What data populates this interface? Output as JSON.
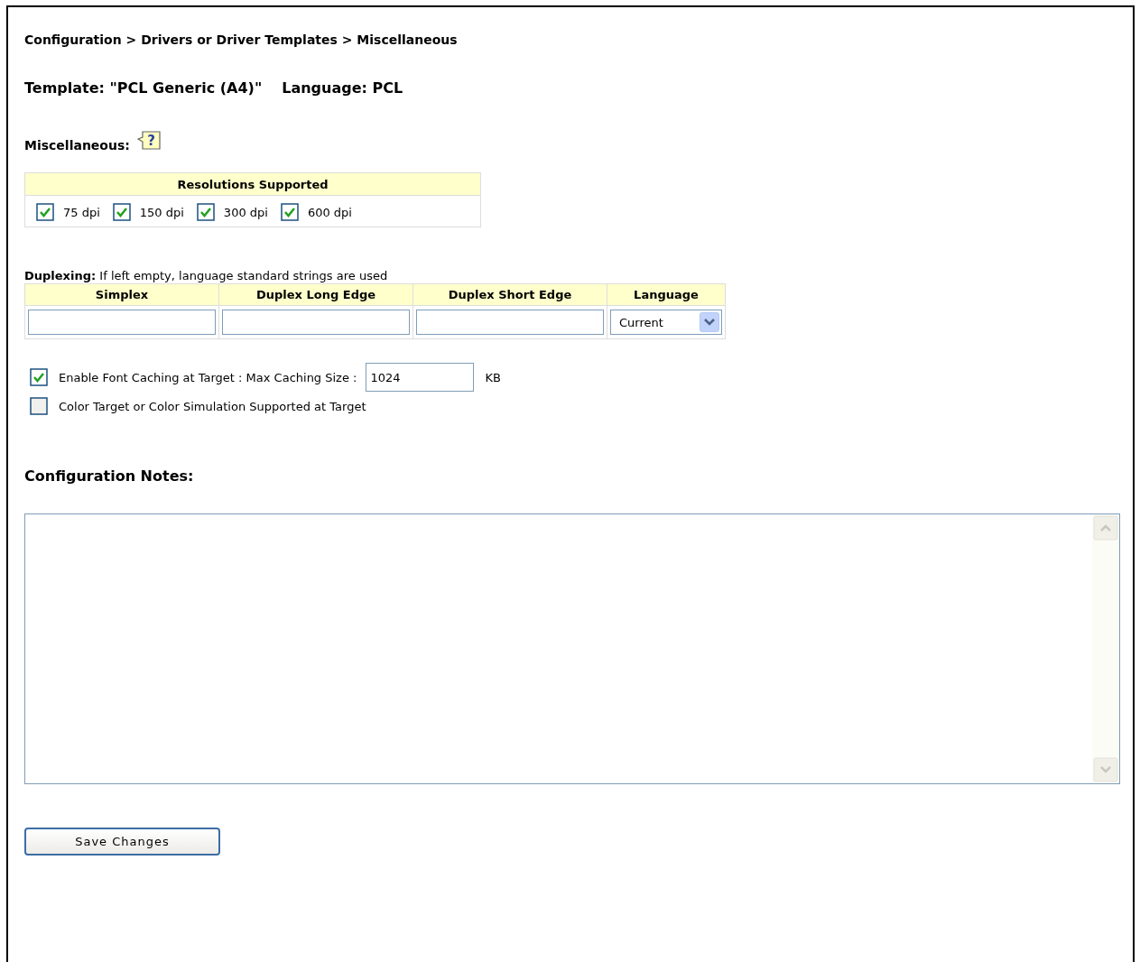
{
  "breadcrumb": "Configuration > Drivers or Driver Templates > Miscellaneous",
  "template": "Template: \"PCL Generic (A4)\"",
  "language": "Language: PCL",
  "section_title": "Miscellaneous:",
  "help_icon": "?",
  "resolutions": {
    "title": "Resolutions Supported",
    "items": [
      {
        "label": "75 dpi",
        "checked": true
      },
      {
        "label": "150 dpi",
        "checked": true
      },
      {
        "label": "300 dpi",
        "checked": true
      },
      {
        "label": "600 dpi",
        "checked": true
      }
    ]
  },
  "duplexing": {
    "note": "**Duplexing:** If left empty, language standard strings are used",
    "columns": [
      "Simplex",
      "Duplex Long Edge",
      "Duplex Short Edge",
      "Language"
    ],
    "language_value": "Current"
  },
  "options": [
    {
      "label": "Enable Font Caching at Target : Max Caching Size :",
      "checked": true,
      "value": "1024",
      "unit": "KB"
    },
    {
      "label": "Color Target or Color Simulation Supported at Target",
      "checked": false
    }
  ],
  "notes_title": "Configuration Notes:",
  "save_button": "Save Changes"
}
